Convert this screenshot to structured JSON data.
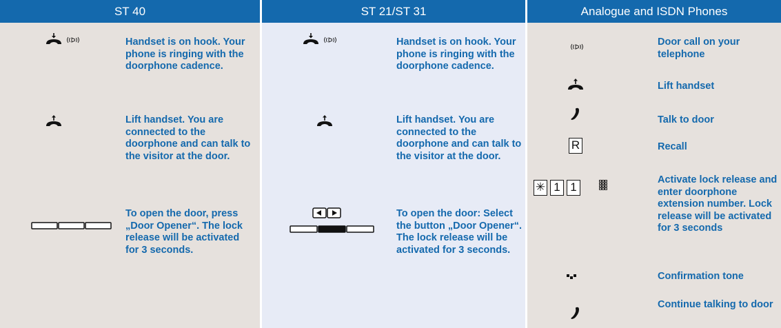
{
  "columns": [
    {
      "title": "ST 40",
      "steps": [
        "Handset is on hook. Your phone is ringing with the doorphone cadence.",
        "Lift handset. You are connected to the doorphone and can talk to the visitor at the door.",
        "To open the door, press „Door Opener“. The lock release will be activated for 3 seconds."
      ],
      "icons": [
        "handset-down-icon",
        "ring-icon",
        "handset-up-icon",
        "three-softkeys-icon"
      ]
    },
    {
      "title": "ST 21/ST 31",
      "steps": [
        "Handset is on hook. Your phone is ringing with the doorphone cadence.",
        "Lift handset. You are connected to the doorphone and can talk to the visitor at the door.",
        "To open the door: Select the button „Door Opener“. The lock release will be activated for 3 seconds."
      ],
      "icons": [
        "handset-down-icon",
        "ring-icon",
        "handset-up-icon",
        "arrow-left-key-icon",
        "arrow-right-key-icon",
        "softkeys-selected-icon"
      ]
    },
    {
      "title": "Analogue and ISDN Phones",
      "steps": [
        "Door call on your telephone",
        "Lift handset",
        "Talk to door",
        "Recall",
        "Activate lock release and enter doorphone extension number. Lock release will be activated for 3 seconds",
        "Confirmation tone",
        "Continue talking to door"
      ],
      "keys": {
        "recall": "R",
        "star": "✳",
        "one_a": "1",
        "one_b": "1"
      },
      "icons": [
        "ring-icon",
        "handset-up-icon",
        "talk-icon",
        "keypad-icon",
        "confirmation-tone-icon"
      ]
    }
  ],
  "colors": {
    "header_bg": "#1469ad",
    "header_text": "#ffffff",
    "instruction_text": "#1469ad",
    "panel_bg_warm": "#e6e1dd",
    "panel_bg_cool": "#e7ebf6"
  }
}
